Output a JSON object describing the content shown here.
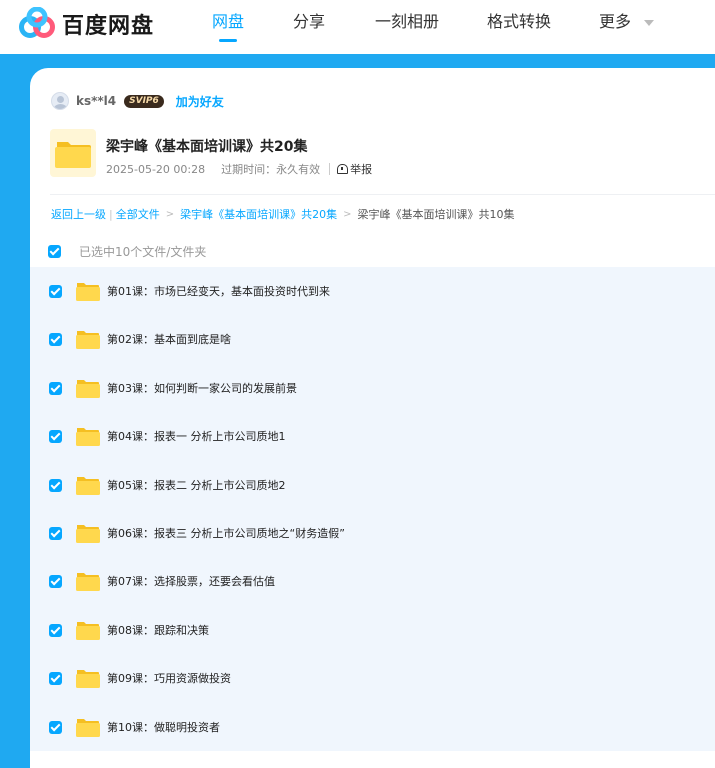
{
  "brand": {
    "name": "百度网盘",
    "logo_icon": "baidu-netdisk-logo"
  },
  "nav": {
    "items": [
      {
        "label": "网盘",
        "active": true
      },
      {
        "label": "分享",
        "active": false
      },
      {
        "label": "一刻相册",
        "active": false
      },
      {
        "label": "格式转换",
        "active": false
      },
      {
        "label": "更多",
        "active": false
      }
    ]
  },
  "sharer": {
    "username": "ks**l4",
    "vip_badge": "SVIP6",
    "add_friend_label": "加为好友"
  },
  "share": {
    "title": "梁宇峰《基本面培训课》共20集",
    "date": "2025-05-20 00:28",
    "expiry_label": "过期时间：",
    "expiry_value": "永久有效",
    "report_label": "举报"
  },
  "breadcrumb": {
    "back_label": "返回上一级",
    "all_files_label": "全部文件",
    "parent_label": "梁宇峰《基本面培训课》共20集",
    "current_label": "梁宇峰《基本面培训课》共10集"
  },
  "selection": {
    "summary": "已选中10个文件/文件夹",
    "checked": true
  },
  "files": [
    {
      "name": "第01课：市场已经变天，基本面投资时代到来",
      "checked": true
    },
    {
      "name": "第02课：基本面到底是啥",
      "checked": true
    },
    {
      "name": "第03课：如何判断一家公司的发展前景",
      "checked": true
    },
    {
      "name": "第04课：报表一 分析上市公司质地1",
      "checked": true
    },
    {
      "name": "第05课：报表二 分析上市公司质地2",
      "checked": true
    },
    {
      "name": "第06课：报表三 分析上市公司质地之“财务造假”",
      "checked": true
    },
    {
      "name": "第07课：选择股票，还要会看估值",
      "checked": true
    },
    {
      "name": "第08课：跟踪和决策",
      "checked": true
    },
    {
      "name": "第09课：巧用资源做投资",
      "checked": true
    },
    {
      "name": "第10课：做聪明投资者",
      "checked": true
    }
  ],
  "colors": {
    "accent": "#06a7ff",
    "band": "#1fa9f1",
    "list_bg": "#f0f6fd",
    "folder": "#ffd84d"
  }
}
